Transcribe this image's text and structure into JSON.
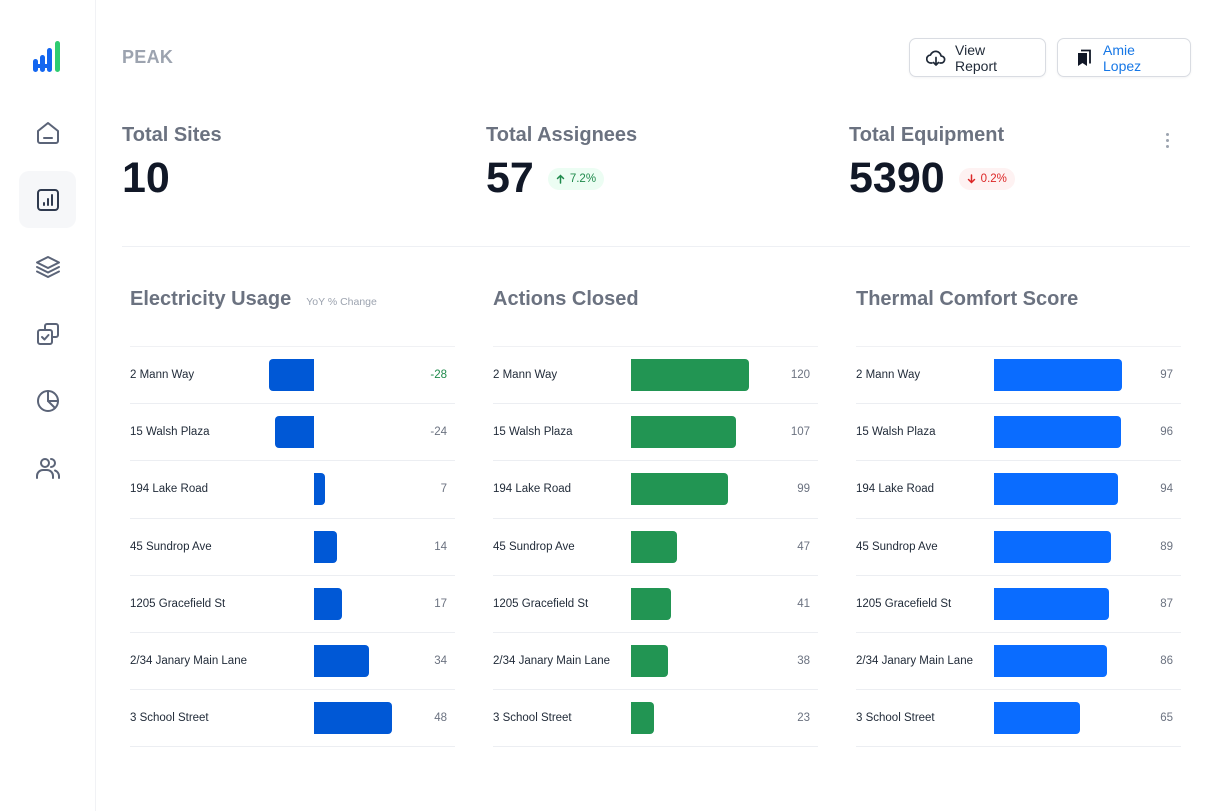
{
  "app": {
    "brand": "PEAK",
    "logo_icon": "bar-chart-logo-icon",
    "colors": {
      "logo_blue": "#1366f0",
      "logo_green": "#2ecc71",
      "electricity_bar": "#0058d6",
      "actions_bar": "#229553",
      "thermal_bar": "#0a6cff",
      "positive": "#1f8a4c",
      "negative": "#dc2626"
    }
  },
  "sidebar": {
    "items": [
      {
        "name": "home",
        "icon": "home-icon",
        "active": false
      },
      {
        "name": "reports",
        "icon": "chart-icon",
        "active": true
      },
      {
        "name": "layers",
        "icon": "layers-icon",
        "active": false
      },
      {
        "name": "tasks",
        "icon": "checkbox-copy-icon",
        "active": false
      },
      {
        "name": "analytics",
        "icon": "pie-chart-icon",
        "active": false
      },
      {
        "name": "users",
        "icon": "users-icon",
        "active": false
      }
    ]
  },
  "header": {
    "view_report_label": "View Report",
    "view_report_icon": "cloud-download-icon",
    "user_label": "Amie Lopez",
    "user_icon": "bookmarks-icon"
  },
  "stats": [
    {
      "label": "Total Sites",
      "value": "10"
    },
    {
      "label": "Total Assignees",
      "value": "57",
      "change": "7.2%",
      "direction": "up"
    },
    {
      "label": "Total Equipment",
      "value": "5390",
      "change": "0.2%",
      "direction": "down"
    }
  ],
  "chart_data": [
    {
      "type": "bar",
      "orientation": "horizontal",
      "title": "Electricity Usage",
      "subtitle": "YoY % Change",
      "categories": [
        "2 Mann Way",
        "15 Walsh Plaza",
        "194 Lake Road",
        "45 Sundrop Ave",
        "1205 Gracefield St",
        "2/34 Janary Main Lane",
        "3 School Street"
      ],
      "values": [
        -28,
        -24,
        7,
        14,
        17,
        34,
        48
      ],
      "highlight": [
        true,
        false,
        false,
        false,
        false,
        false,
        false
      ],
      "color": "#0058d6",
      "xlim": [
        -60,
        60
      ]
    },
    {
      "type": "bar",
      "orientation": "horizontal",
      "title": "Actions Closed",
      "categories": [
        "2 Mann Way",
        "15 Walsh Plaza",
        "194 Lake Road",
        "45 Sundrop Ave",
        "1205 Gracefield St",
        "2/34 Janary Main Lane",
        "3 School Street"
      ],
      "values": [
        120,
        107,
        99,
        47,
        41,
        38,
        23
      ],
      "color": "#229553",
      "xlim": [
        0,
        120
      ]
    },
    {
      "type": "bar",
      "orientation": "horizontal",
      "title": "Thermal Comfort Score",
      "categories": [
        "2 Mann Way",
        "15 Walsh Plaza",
        "194 Lake Road",
        "45 Sundrop Ave",
        "1205 Gracefield St",
        "2/34 Janary Main Lane",
        "3 School Street"
      ],
      "values": [
        97,
        96,
        94,
        89,
        87,
        86,
        65
      ],
      "color": "#0a6cff",
      "xlim": [
        0,
        97
      ]
    }
  ]
}
